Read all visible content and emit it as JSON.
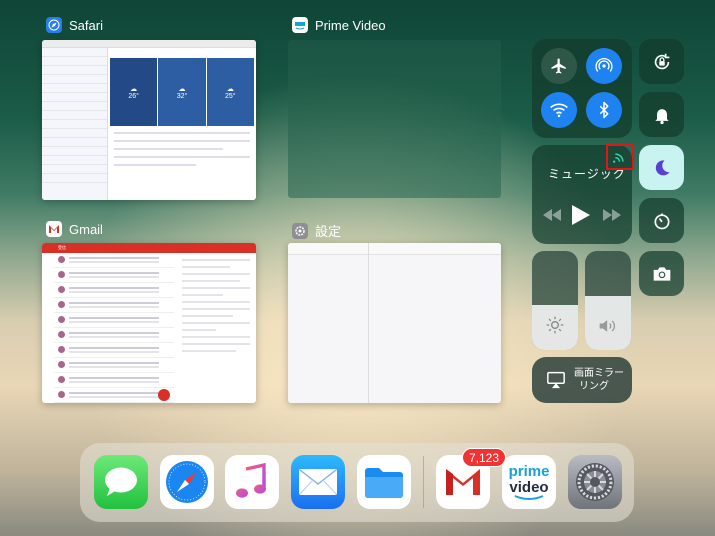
{
  "app_switcher": {
    "cards": [
      {
        "label": "Safari"
      },
      {
        "label": "Prime Video"
      },
      {
        "label": "Gmail"
      },
      {
        "label": "設定"
      }
    ],
    "safari_weather": [
      {
        "temp": "26°"
      },
      {
        "temp": "32°"
      },
      {
        "temp": "25°"
      }
    ],
    "gmail_inbox_label": "受信"
  },
  "control_center": {
    "music_title": "ミュージック",
    "screen_mirroring_label_line1": "画面ミラー",
    "screen_mirroring_label_line2": "リング",
    "brightness_level": 0.45,
    "volume_level": 0.55,
    "highlight_color": "#e0161b",
    "active_blue": "#1e82f0"
  },
  "dock": {
    "apps": [
      {
        "icon": "messages-icon"
      },
      {
        "icon": "safari-icon"
      },
      {
        "icon": "music-icon"
      },
      {
        "icon": "mail-icon"
      },
      {
        "icon": "files-icon"
      },
      {
        "icon": "gmail-icon",
        "badge": "7,123"
      },
      {
        "icon": "prime-video-icon",
        "text_line1": "prime",
        "text_line2": "video"
      },
      {
        "icon": "settings-icon"
      }
    ]
  }
}
